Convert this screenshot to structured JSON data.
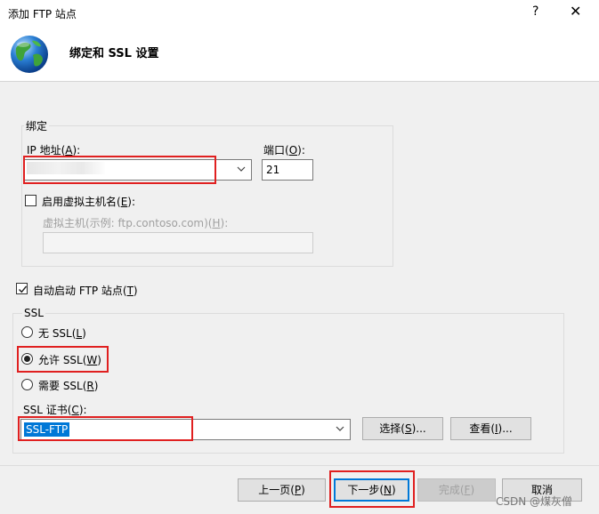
{
  "window": {
    "title": "添加 FTP 站点",
    "help_glyph": "?",
    "close_glyph": "✕"
  },
  "header": {
    "icon": "globe-icon",
    "heading": "绑定和 SSL 设置"
  },
  "binding": {
    "group_label": "绑定",
    "ip_label": "IP 地址(",
    "ip_key": "A",
    "ip_label_end": "):",
    "ip_value": "",
    "port_label": "端口(",
    "port_key": "O",
    "port_label_end": "):",
    "port_value": "21",
    "vhost_checkbox_label": "启用虚拟主机名(",
    "vhost_key": "E",
    "vhost_label_end": "):",
    "vhost_checked": false,
    "vhost_field_label": "虚拟主机(示例: ftp.contoso.com)(",
    "vhost_field_key": "H",
    "vhost_field_label_end": "):",
    "vhost_value": ""
  },
  "autostart": {
    "label": "自动启动 FTP 站点(",
    "key": "T",
    "label_end": ")",
    "checked": true
  },
  "ssl": {
    "group_label": "SSL",
    "options": [
      {
        "label": "无 SSL(",
        "key": "L",
        "end": ")",
        "selected": false
      },
      {
        "label": "允许 SSL(",
        "key": "W",
        "end": ")",
        "selected": true
      },
      {
        "label": "需要 SSL(",
        "key": "R",
        "end": ")",
        "selected": false
      }
    ],
    "cert_label": "SSL 证书(",
    "cert_key": "C",
    "cert_label_end": "):",
    "cert_value": "SSL-FTP",
    "select_button": "选择(",
    "select_key": "S",
    "select_end": ")...",
    "view_button": "查看(",
    "view_key": "I",
    "view_end": ")..."
  },
  "footer": {
    "prev": "上一页(",
    "prev_key": "P",
    "prev_end": ")",
    "next": "下一步(",
    "next_key": "N",
    "next_end": ")",
    "finish": "完成(",
    "finish_key": "F",
    "finish_end": ")",
    "cancel": "取消"
  },
  "watermark": "CSDN @煤灰僧",
  "colors": {
    "accent": "#0078d7",
    "highlight_red": "#e02020"
  }
}
